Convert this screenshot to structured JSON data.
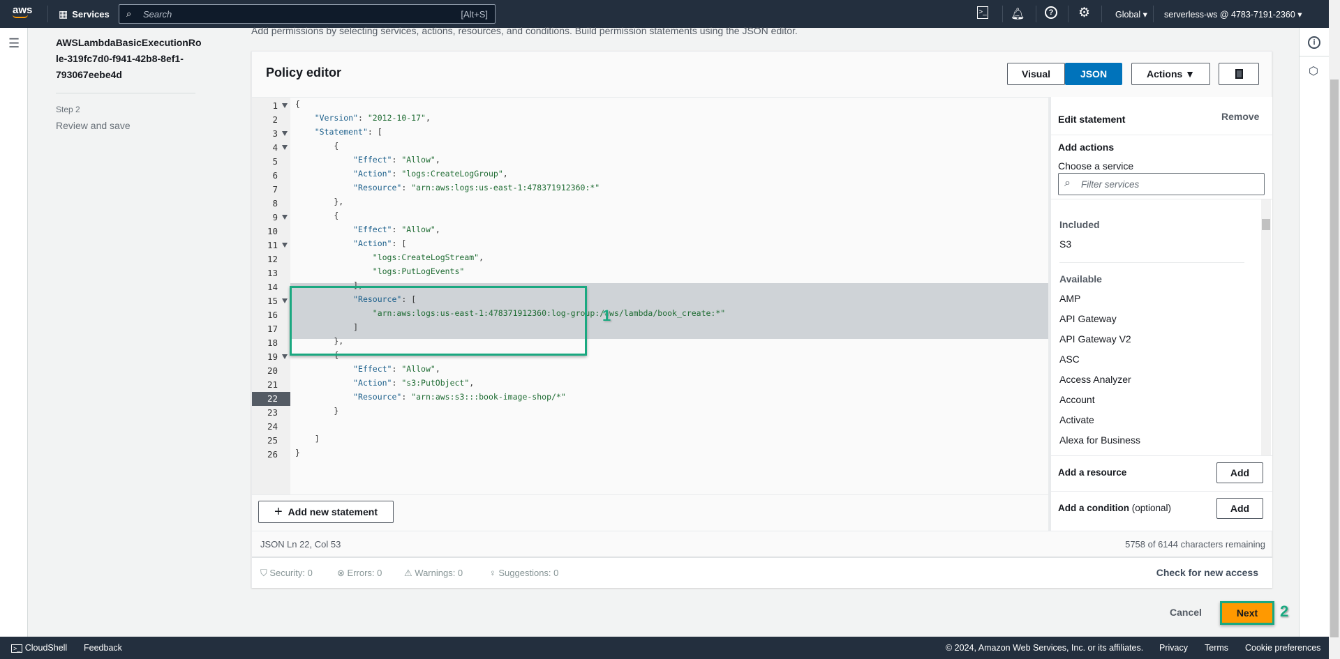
{
  "nav": {
    "logo": "aws",
    "services": "Services",
    "search_placeholder": "Search",
    "search_shortcut": "[Alt+S]",
    "region": "Global",
    "account": "serverless-ws @ 4783-7191-2360"
  },
  "left": {
    "role_lines": [
      "AWSLambdaBasicExecutionRo",
      "le-319fc7d0-f941-42b8-8ef1-",
      "793067eebe4d"
    ],
    "step_label": "Step 2",
    "step_title": "Review and save"
  },
  "subtitle": "Add permissions by selecting services, actions, resources, and conditions. Build permission statements using the JSON editor.",
  "editor": {
    "title": "Policy editor",
    "visual": "Visual",
    "json": "JSON",
    "actions": "Actions",
    "active_line": 22,
    "fold_lines": [
      1,
      3,
      4,
      9,
      11,
      15,
      19
    ],
    "lines": [
      "{",
      "    \"Version\": \"2012-10-17\",",
      "    \"Statement\": [",
      "        {",
      "            \"Effect\": \"Allow\",",
      "            \"Action\": \"logs:CreateLogGroup\",",
      "            \"Resource\": \"arn:aws:logs:us-east-1:478371912360:*\"",
      "        },",
      "        {",
      "            \"Effect\": \"Allow\",",
      "            \"Action\": [",
      "                \"logs:CreateLogStream\",",
      "                \"logs:PutLogEvents\"",
      "            ],",
      "            \"Resource\": [",
      "                \"arn:aws:logs:us-east-1:478371912360:log-group:/aws/lambda/book_create:*\"",
      "            ]",
      "        },",
      "        {",
      "            \"Effect\": \"Allow\",",
      "            \"Action\": \"s3:PutObject\",",
      "            \"Resource\": \"arn:aws:s3:::book-image-shop/*\"",
      "        }",
      "",
      "    ]",
      "}"
    ],
    "add_statement": "Add new statement",
    "status_mode": "JSON",
    "status_pos": "Ln 22, Col 53",
    "chars_remaining": "5758 of 6144 characters remaining",
    "security": "Security: 0",
    "errors": "Errors: 0",
    "warnings": "Warnings: 0",
    "suggestions": "Suggestions: 0",
    "check_access": "Check for new access"
  },
  "side": {
    "edit_statement": "Edit statement",
    "remove": "Remove",
    "add_actions": "Add actions",
    "choose_service": "Choose a service",
    "filter_placeholder": "Filter services",
    "included_label": "Included",
    "included": [
      "S3"
    ],
    "available_label": "Available",
    "available": [
      "AMP",
      "API Gateway",
      "API Gateway V2",
      "ASC",
      "Access Analyzer",
      "Account",
      "Activate",
      "Alexa for Business"
    ],
    "add_resource": "Add a resource",
    "add_condition": "Add a condition",
    "optional": "(optional)",
    "add": "Add"
  },
  "annotations": {
    "one": "1",
    "two": "2"
  },
  "actions": {
    "cancel": "Cancel",
    "next": "Next"
  },
  "footer": {
    "cloudshell": "CloudShell",
    "feedback": "Feedback",
    "copyright": "© 2024, Amazon Web Services, Inc. or its affiliates.",
    "privacy": "Privacy",
    "terms": "Terms",
    "cookies": "Cookie preferences"
  },
  "colors": {
    "nav": "#232f3e",
    "accent": "#0073bb",
    "next": "#ff9900",
    "annotation": "#1aa880"
  }
}
